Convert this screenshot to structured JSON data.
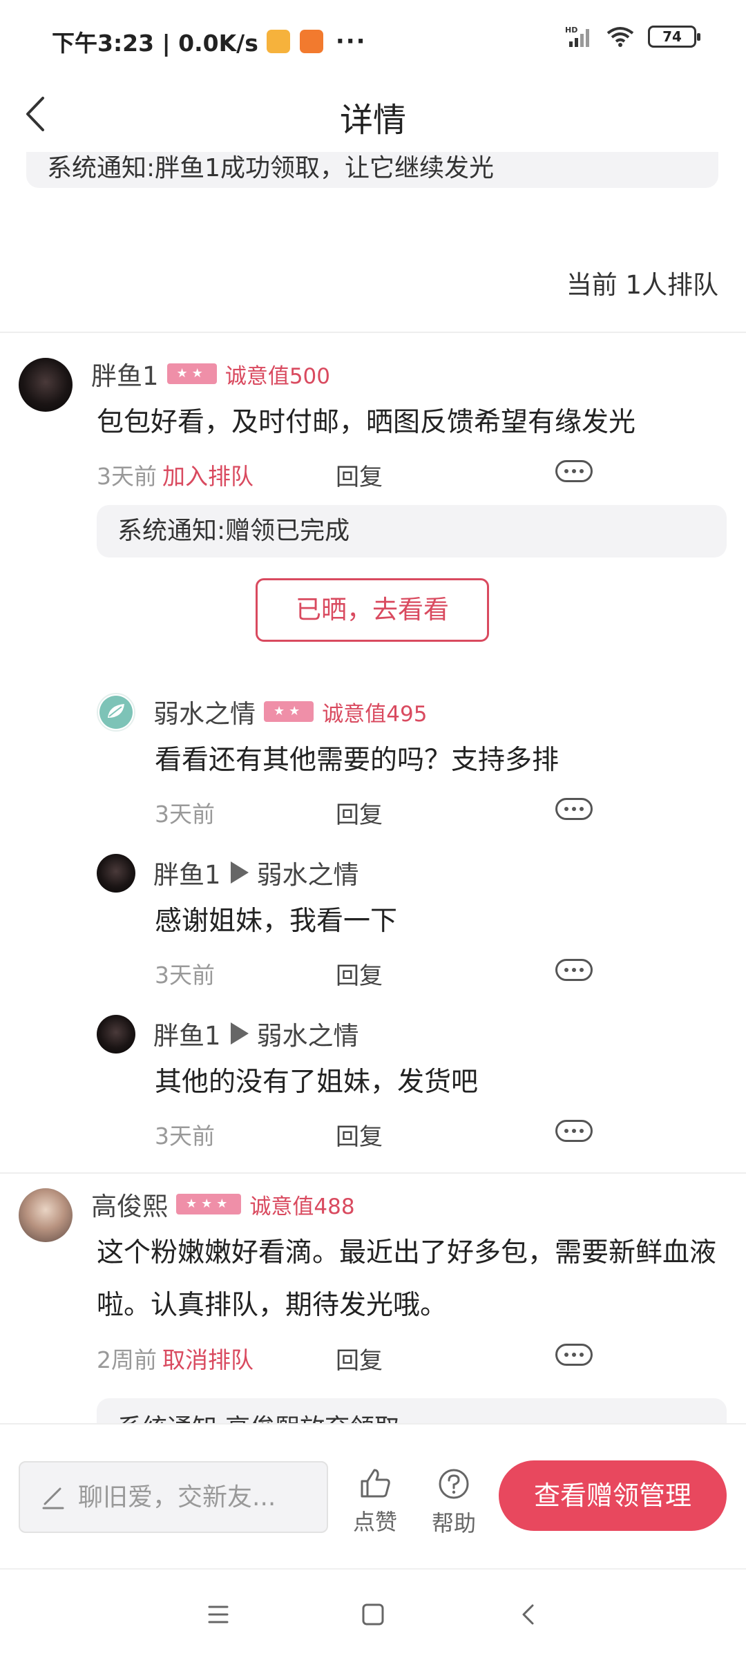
{
  "status_bar": {
    "left_text": "下午3:23 | 0.0K/s",
    "more_glyph": "···",
    "network_label": "HD",
    "battery_level": "74",
    "icons": [
      "app-notification-icon",
      "app-store-icon",
      "signal-icon",
      "wifi-icon",
      "battery-icon"
    ]
  },
  "header": {
    "title": "详情",
    "back_icon": "chevron-left-icon"
  },
  "top_notice": "系统通知:胖鱼1成功领取，让它继续发光",
  "queue_text": "当前 1人排队",
  "comments": [
    {
      "user": "胖鱼1",
      "stars": "★★",
      "sincerity": "诚意值500",
      "text": "包包好看，及时付邮，晒图反馈希望有缘发光",
      "time": "3天前",
      "action": "加入排队",
      "reply_label": "回复",
      "system_notice": "系统通知:赠领已完成",
      "posted_button": "已晒，去看看",
      "replies": [
        {
          "user": "弱水之情",
          "stars": "★★",
          "sincerity": "诚意值495",
          "text": "看看还有其他需要的吗？支持多排",
          "time": "3天前",
          "reply_label": "回复"
        },
        {
          "user": "胖鱼1",
          "to_user": "弱水之情",
          "text": "感谢姐妹，我看一下",
          "time": "3天前",
          "reply_label": "回复"
        },
        {
          "user": "胖鱼1",
          "to_user": "弱水之情",
          "text": "其他的没有了姐妹，发货吧",
          "time": "3天前",
          "reply_label": "回复"
        }
      ]
    },
    {
      "user": "高俊熙",
      "stars": "★★★",
      "sincerity": "诚意值488",
      "text": "这个粉嫩嫩好看滴。最近出了好多包，需要新鲜血液啦。认真排队，期待发光哦。",
      "time": "2周前",
      "action": "取消排队",
      "reply_label": "回复",
      "system_notice": "系统通知:高俊熙放弃领取"
    }
  ],
  "bottom_bar": {
    "input_placeholder": "聊旧爱，交新友...",
    "like_label": "点赞",
    "help_label": "帮助",
    "manage_button": "查看赠领管理"
  },
  "colors": {
    "accent": "#e8485e",
    "sincerity_text": "#d94a5f",
    "star_badge": "#ef8fa8",
    "notice_bg": "#f3f3f5"
  }
}
